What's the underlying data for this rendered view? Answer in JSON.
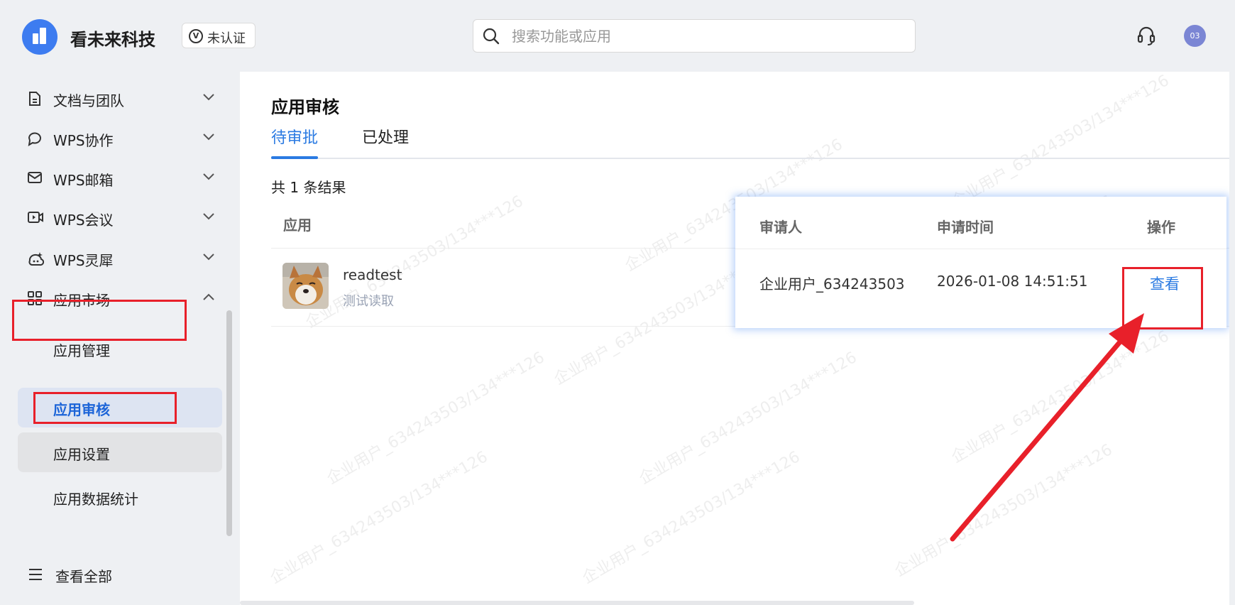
{
  "header": {
    "company": "看未来科技",
    "verify_label": "未认证",
    "search_placeholder": "搜索功能或应用",
    "avatar_text": "03"
  },
  "sidebar": {
    "items": [
      {
        "label": "文档与团队",
        "icon": "document-icon"
      },
      {
        "label": "WPS协作",
        "icon": "chat-icon"
      },
      {
        "label": "WPS邮箱",
        "icon": "mail-icon"
      },
      {
        "label": "WPS会议",
        "icon": "video-icon"
      },
      {
        "label": "WPS灵犀",
        "icon": "ai-icon"
      },
      {
        "label": "应用市场",
        "icon": "grid-icon"
      }
    ],
    "subitems": [
      {
        "label": "应用管理"
      },
      {
        "label": "应用审核"
      },
      {
        "label": "应用设置"
      },
      {
        "label": "应用数据统计"
      }
    ],
    "view_all": "查看全部"
  },
  "main": {
    "title": "应用审核",
    "tabs": [
      {
        "label": "待审批"
      },
      {
        "label": "已处理"
      }
    ],
    "count_text": "共 1 条结果",
    "columns": {
      "app": "应用",
      "applicant": "审请人",
      "time": "申请时间",
      "action": "操作"
    },
    "rows": [
      {
        "app_name": "readtest",
        "app_desc": "测试读取",
        "applicant": "企业用户_634243503",
        "time": "2026-01-08 14:51:51",
        "action": "查看"
      }
    ],
    "watermark": "企业用户_634243503/134***126"
  },
  "colors": {
    "accent": "#2a7ae2",
    "annotation": "#e8202a",
    "sidebar_active_bg": "#dde4f2"
  }
}
